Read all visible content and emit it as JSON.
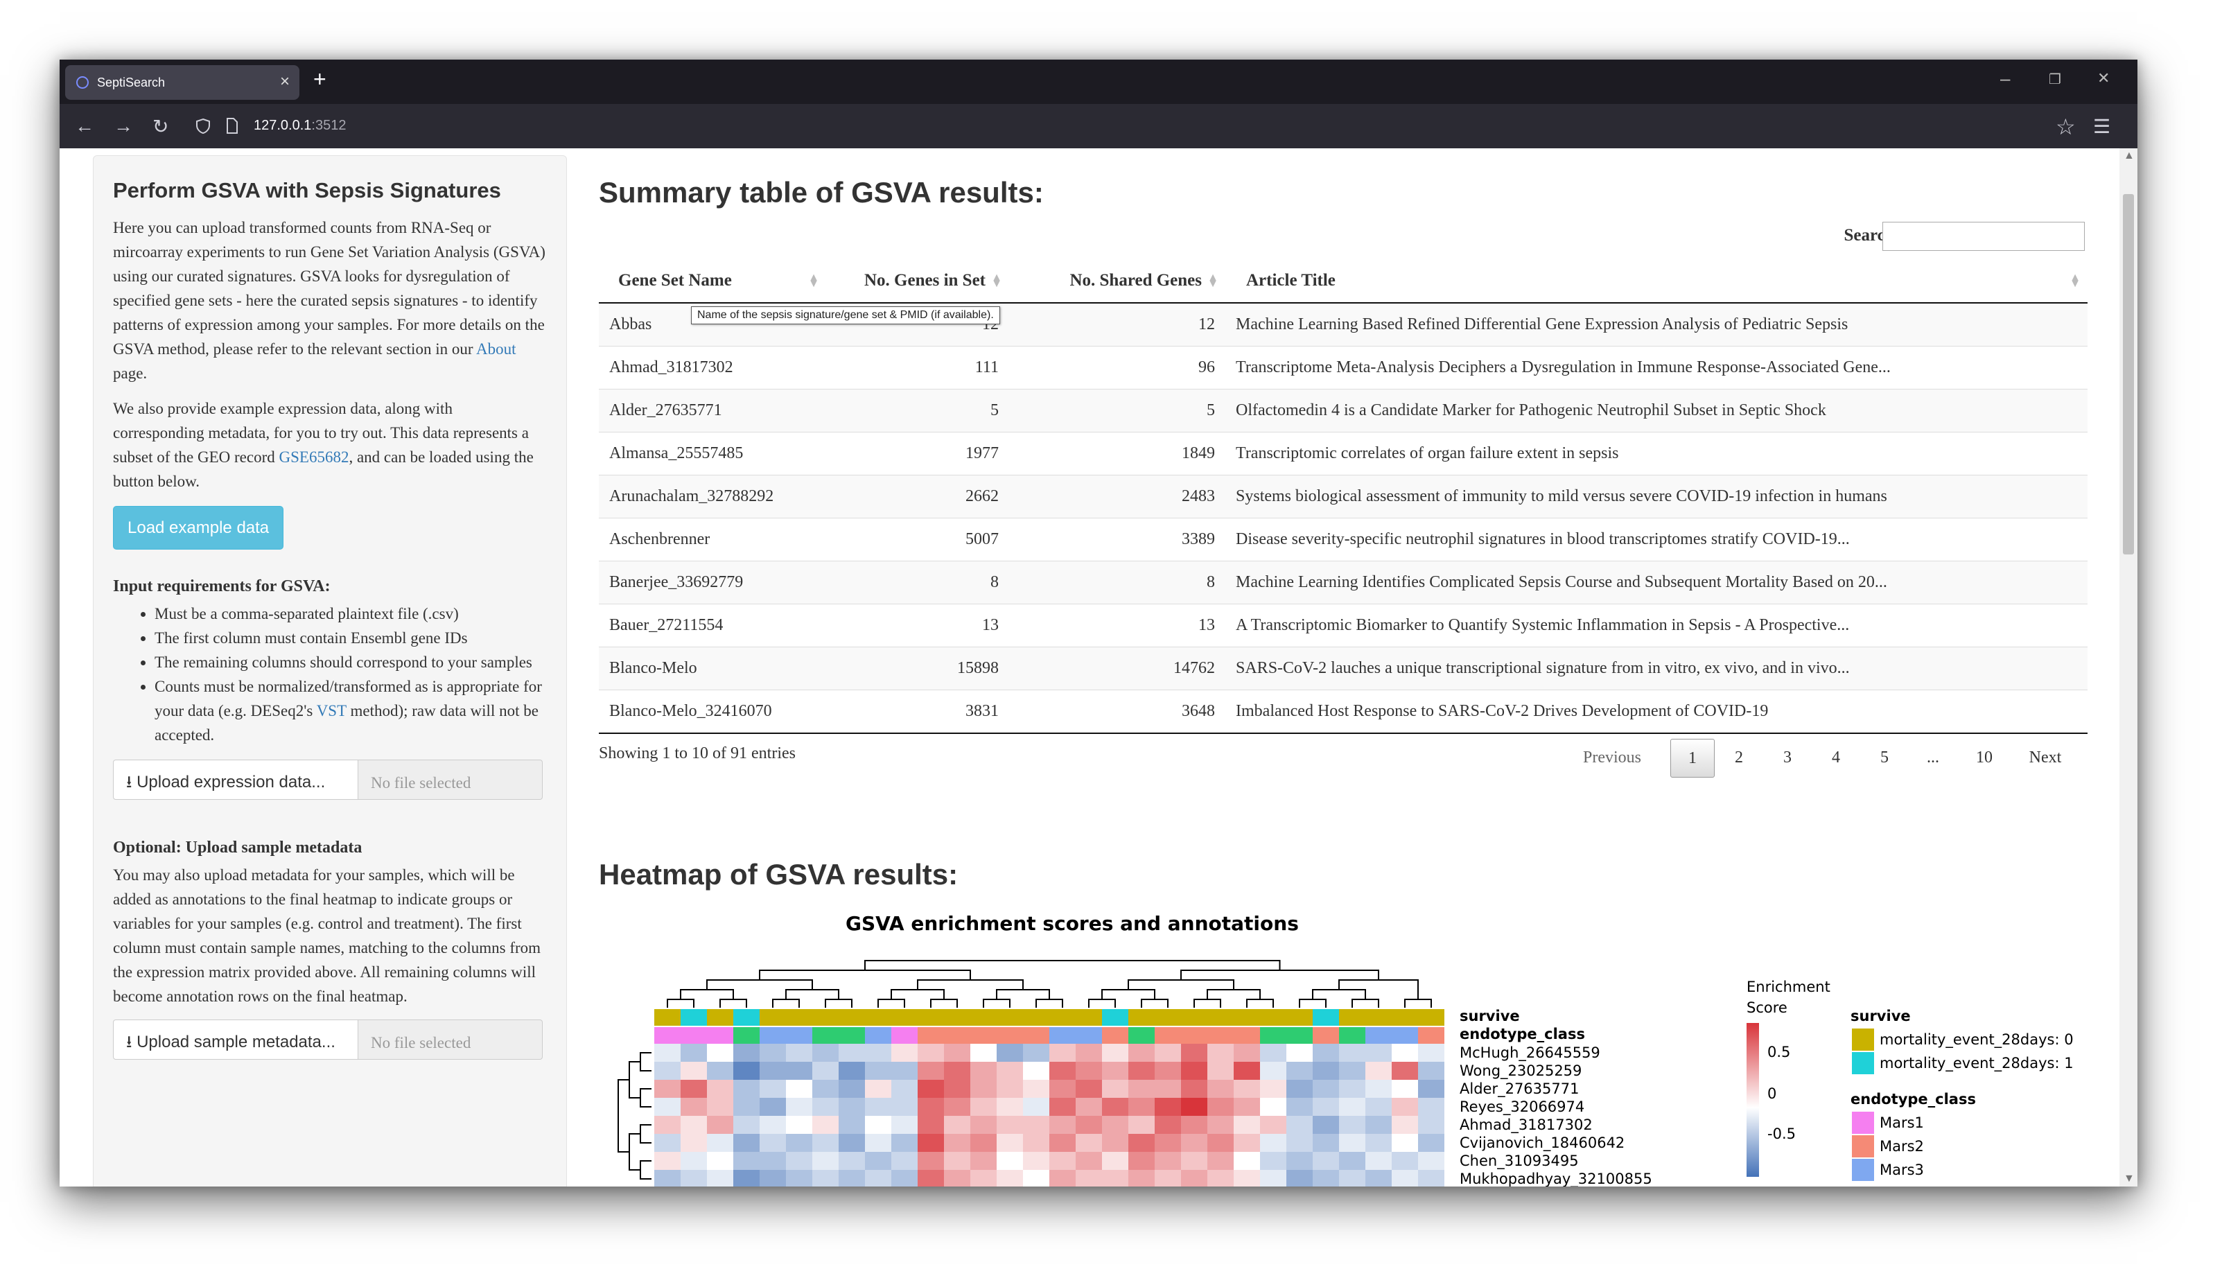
{
  "browser": {
    "tab_title": "SeptiSearch",
    "tab_close": "×",
    "new_tab": "+",
    "url_host": "127.0.0.1",
    "url_port": ":3512",
    "back": "←",
    "forward": "→",
    "reload": "↻",
    "star": "☆",
    "menu": "☰",
    "minimize": "–",
    "restore": "❐",
    "close": "✕"
  },
  "sidebar": {
    "title": "Perform GSVA with Sepsis Signatures",
    "p1_text": "Here you can upload transformed counts from RNA-Seq or mircoarray experiments to run Gene Set Variation Analysis (GSVA) using our curated signatures. GSVA looks for dysregulation of specified gene sets - here the curated sepsis signatures - to identify patterns of expression among your samples. For more details on the GSVA method, please refer to the relevant section in our ",
    "p1_link": "About",
    "p1_end": " page.",
    "p2_text": "We also provide example expression data, along with corresponding metadata, for you to try out. This data represents a subset of the GEO record ",
    "p2_link": "GSE65682",
    "p2_end": ", and can be loaded using the button below.",
    "load_button": "Load example data",
    "req_heading": "Input requirements for GSVA:",
    "req_items": [
      "Must be a comma-separated plaintext file (.csv)",
      "The first column must contain Ensembl gene IDs",
      "The remaining columns should correspond to your samples"
    ],
    "req_last_text": "Counts must be normalized/transformed as is appropriate for your data (e.g. DESeq2's ",
    "req_last_link": "VST",
    "req_last_end": " method); raw data will not be accepted.",
    "upload_expr_label": "Upload expression data...",
    "upload_expr_file": "No file selected",
    "meta_heading": "Optional: Upload sample metadata",
    "meta_text": "You may also upload metadata for your samples, which will be added as annotations to the final heatmap to indicate groups or variables for your samples (e.g. control and treatment). The first column must contain sample names, matching to the columns from the expression matrix provided above. All remaining columns will become annotation rows on the final heatmap.",
    "upload_meta_label": "Upload sample metadata...",
    "upload_meta_file": "No file selected",
    "upload_icon": "⭳"
  },
  "summary": {
    "title": "Summary table of GSVA results:",
    "search_label": "Search:",
    "search_value": "",
    "columns": [
      "Gene Set Name",
      "No. Genes in Set",
      "No. Shared Genes",
      "Article Title"
    ],
    "rows": [
      [
        "Abbas",
        "12",
        "12",
        "Machine Learning Based Refined Differential Gene Expression Analysis of Pediatric Sepsis"
      ],
      [
        "Ahmad_31817302",
        "111",
        "96",
        "Transcriptome Meta-Analysis Deciphers a Dysregulation in Immune Response-Associated Gene..."
      ],
      [
        "Alder_27635771",
        "5",
        "5",
        "Olfactomedin 4 is a Candidate Marker for Pathogenic Neutrophil Subset in Septic Shock"
      ],
      [
        "Almansa_25557485",
        "1977",
        "1849",
        "Transcriptomic correlates of organ failure extent in sepsis"
      ],
      [
        "Arunachalam_32788292",
        "2662",
        "2483",
        "Systems biological assessment of immunity to mild versus severe COVID-19 infection in humans"
      ],
      [
        "Aschenbrenner",
        "5007",
        "3389",
        "Disease severity-specific neutrophil signatures in blood transcriptomes stratify COVID-19..."
      ],
      [
        "Banerjee_33692779",
        "8",
        "8",
        "Machine Learning Identifies Complicated Sepsis Course and Subsequent Mortality Based on 20..."
      ],
      [
        "Bauer_27211554",
        "13",
        "13",
        "A Transcriptomic Biomarker to Quantify Systemic Inflammation in Sepsis - A Prospective..."
      ],
      [
        "Blanco-Melo",
        "15898",
        "14762",
        "SARS-CoV-2 lauches a unique transcriptional signature from in vitro, ex vivo, and in vivo..."
      ],
      [
        "Blanco-Melo_32416070",
        "3831",
        "3648",
        "Imbalanced Host Response to SARS-CoV-2 Drives Development of COVID-19"
      ]
    ],
    "tooltip": "Name of the sepsis signature/gene set & PMID (if available).",
    "info": "Showing 1 to 10 of 91 entries",
    "pagination": {
      "previous": "Previous",
      "pages": [
        "1",
        "2",
        "3",
        "4",
        "5",
        "...",
        "10"
      ],
      "next": "Next",
      "current": "1"
    }
  },
  "heatmap": {
    "section_title": "Heatmap of GSVA results:",
    "plot_title": "GSVA enrichment scores and annotations",
    "annotation_rows": [
      "survive",
      "endotype_class"
    ],
    "row_labels": [
      "McHugh_26645559",
      "Wong_23025259",
      "Alder_27635771",
      "Reyes_32066974",
      "Ahmad_31817302",
      "Cvijanovich_18460642",
      "Chen_31093495",
      "Mukhopadhyay_32100855"
    ],
    "legend": {
      "score_title_1": "Enrichment",
      "score_title_2": "Score",
      "score_ticks": [
        "0.5",
        "0",
        "-0.5"
      ],
      "survive_title": "survive",
      "survive_items": [
        {
          "label": "mortality_event_28days: 0",
          "color": "#c9b200"
        },
        {
          "label": "mortality_event_28days: 1",
          "color": "#1fd1d8"
        }
      ],
      "endotype_title": "endotype_class",
      "endotype_items": [
        {
          "label": "Mars1",
          "color": "#f57ff0"
        },
        {
          "label": "Mars2",
          "color": "#f58a76"
        },
        {
          "label": "Mars3",
          "color": "#7fa8f0"
        }
      ]
    },
    "colors": {
      "high": "#d8343a",
      "mid": "#ffffff",
      "low": "#4472b8"
    },
    "survive_strip": [
      0,
      1,
      0,
      1,
      0,
      0,
      0,
      0,
      0,
      0,
      0,
      0,
      0,
      0,
      0,
      0,
      0,
      1,
      0,
      0,
      0,
      0,
      0,
      0,
      0,
      1,
      0,
      0,
      0,
      0
    ],
    "endotype_strip": [
      0,
      0,
      0,
      3,
      2,
      2,
      3,
      3,
      2,
      0,
      1,
      1,
      1,
      1,
      1,
      2,
      2,
      1,
      3,
      1,
      1,
      1,
      1,
      3,
      3,
      1,
      3,
      2,
      2,
      1
    ],
    "matrix": [
      [
        -0.1,
        -0.3,
        0.0,
        -0.4,
        -0.3,
        -0.2,
        -0.3,
        -0.2,
        -0.2,
        0.1,
        0.2,
        0.3,
        0.0,
        -0.4,
        -0.3,
        0.2,
        0.3,
        0.1,
        0.3,
        0.2,
        0.5,
        0.2,
        0.3,
        -0.2,
        0.0,
        -0.3,
        -0.2,
        -0.2,
        0.0,
        -0.1
      ],
      [
        -0.2,
        0.1,
        -0.3,
        -0.6,
        -0.4,
        -0.4,
        -0.2,
        -0.5,
        -0.3,
        -0.3,
        0.4,
        0.5,
        0.3,
        0.2,
        0.0,
        0.5,
        0.4,
        0.3,
        0.5,
        0.4,
        0.6,
        0.2,
        0.6,
        -0.1,
        -0.3,
        -0.4,
        -0.3,
        0.1,
        0.5,
        -0.3
      ],
      [
        0.3,
        0.5,
        0.2,
        -0.3,
        -0.2,
        0.0,
        -0.3,
        -0.4,
        0.1,
        -0.2,
        0.6,
        0.5,
        0.3,
        0.2,
        0.1,
        0.4,
        0.5,
        0.2,
        0.3,
        0.3,
        0.5,
        0.3,
        0.2,
        0.1,
        -0.4,
        -0.3,
        -0.2,
        -0.1,
        0.0,
        -0.4
      ],
      [
        -0.1,
        0.3,
        0.2,
        -0.3,
        -0.4,
        -0.1,
        -0.2,
        -0.3,
        -0.2,
        -0.2,
        0.5,
        0.4,
        0.2,
        0.1,
        -0.1,
        0.5,
        0.3,
        0.5,
        0.4,
        0.6,
        0.7,
        0.4,
        0.3,
        0.0,
        -0.3,
        -0.2,
        -0.1,
        -0.2,
        0.2,
        -0.2
      ],
      [
        0.2,
        0.1,
        0.3,
        -0.2,
        -0.1,
        0.0,
        0.1,
        -0.3,
        0.0,
        -0.1,
        0.5,
        0.2,
        0.3,
        0.2,
        0.2,
        0.3,
        0.4,
        0.3,
        0.2,
        0.5,
        0.4,
        0.3,
        0.1,
        0.2,
        -0.2,
        -0.4,
        -0.2,
        -0.3,
        0.1,
        -0.2
      ],
      [
        -0.2,
        0.1,
        -0.1,
        -0.4,
        -0.2,
        -0.3,
        -0.2,
        -0.4,
        -0.1,
        -0.3,
        0.6,
        0.3,
        0.4,
        0.1,
        0.2,
        0.4,
        0.2,
        0.3,
        0.5,
        0.4,
        0.3,
        0.4,
        0.2,
        -0.1,
        -0.2,
        -0.3,
        -0.1,
        -0.2,
        0.0,
        -0.3
      ],
      [
        0.1,
        -0.1,
        0.0,
        -0.3,
        -0.3,
        -0.2,
        -0.1,
        -0.2,
        -0.3,
        -0.2,
        0.4,
        0.2,
        0.3,
        0.0,
        0.1,
        0.2,
        0.3,
        0.1,
        0.4,
        0.3,
        0.2,
        0.3,
        0.0,
        -0.2,
        -0.3,
        -0.2,
        -0.3,
        -0.1,
        -0.2,
        -0.1
      ],
      [
        -0.3,
        -0.2,
        -0.1,
        -0.5,
        -0.4,
        -0.3,
        -0.2,
        -0.3,
        -0.2,
        -0.3,
        0.5,
        0.3,
        0.2,
        0.1,
        0.0,
        0.3,
        0.2,
        0.2,
        0.3,
        0.2,
        0.3,
        0.2,
        0.1,
        -0.1,
        -0.4,
        -0.3,
        -0.2,
        -0.3,
        -0.1,
        -0.2
      ]
    ]
  }
}
